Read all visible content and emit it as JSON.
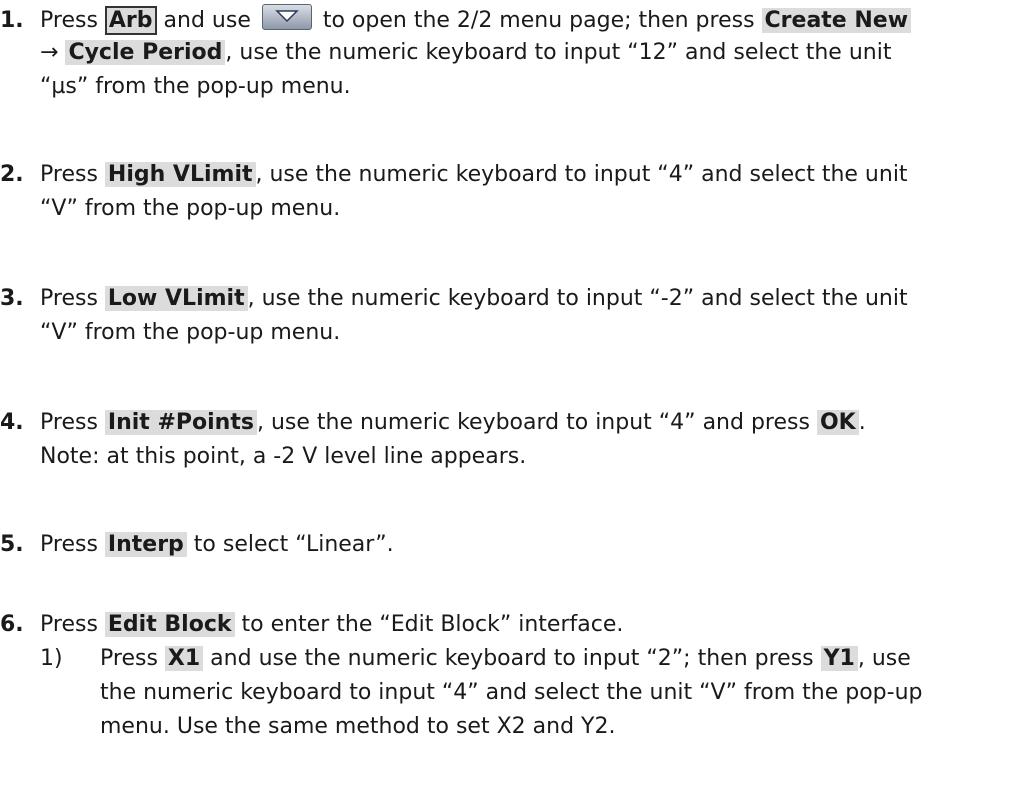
{
  "steps": [
    {
      "num": "1.",
      "line1": {
        "t1": "Press ",
        "k1": "Arb",
        "t2": " and use ",
        "t3": " to open the 2/2 menu page; then press ",
        "k2": "Create New"
      },
      "line2": {
        "arrow": "→ ",
        "k1": "Cycle Period",
        "t1": ", use the numeric keyboard to input “12” and select the unit"
      },
      "line3": "“µs” from the pop-up menu."
    },
    {
      "num": "2.",
      "line1": {
        "t1": "Press ",
        "k1": "High VLimit",
        "t2": ", use the numeric keyboard to input “4” and select the unit"
      },
      "line2": "“V” from the pop-up menu."
    },
    {
      "num": "3.",
      "line1": {
        "t1": "Press ",
        "k1": "Low VLimit",
        "t2": ", use the numeric keyboard to input “-2” and select the unit"
      },
      "line2": "“V” from the pop-up menu."
    },
    {
      "num": "4.",
      "line1": {
        "t1": "Press ",
        "k1": "Init #Points",
        "t2": ", use the numeric keyboard to input “4” and press ",
        "k2": "OK",
        "t3": "."
      },
      "line2": "Note: at this point, a -2 V level line appears."
    },
    {
      "num": "5.",
      "line1": {
        "t1": "Press ",
        "k1": "Interp",
        "t2": " to select “Linear”."
      }
    },
    {
      "num": "6.",
      "line1": {
        "t1": "Press ",
        "k1": "Edit Block",
        "t2": " to enter the “Edit Block” interface."
      },
      "sub": {
        "num": "1)",
        "line1": {
          "t1": "Press ",
          "k1": "X1",
          "t2": " and use the numeric keyboard to input “2”; then press ",
          "k2": "Y1",
          "t3": ", use"
        },
        "line2": "the numeric keyboard to input “4” and select the unit “V” from the pop-up",
        "line3": "menu. Use the same method to set X2 and Y2."
      }
    }
  ],
  "icons": {
    "down_button": "down-arrow-icon"
  }
}
